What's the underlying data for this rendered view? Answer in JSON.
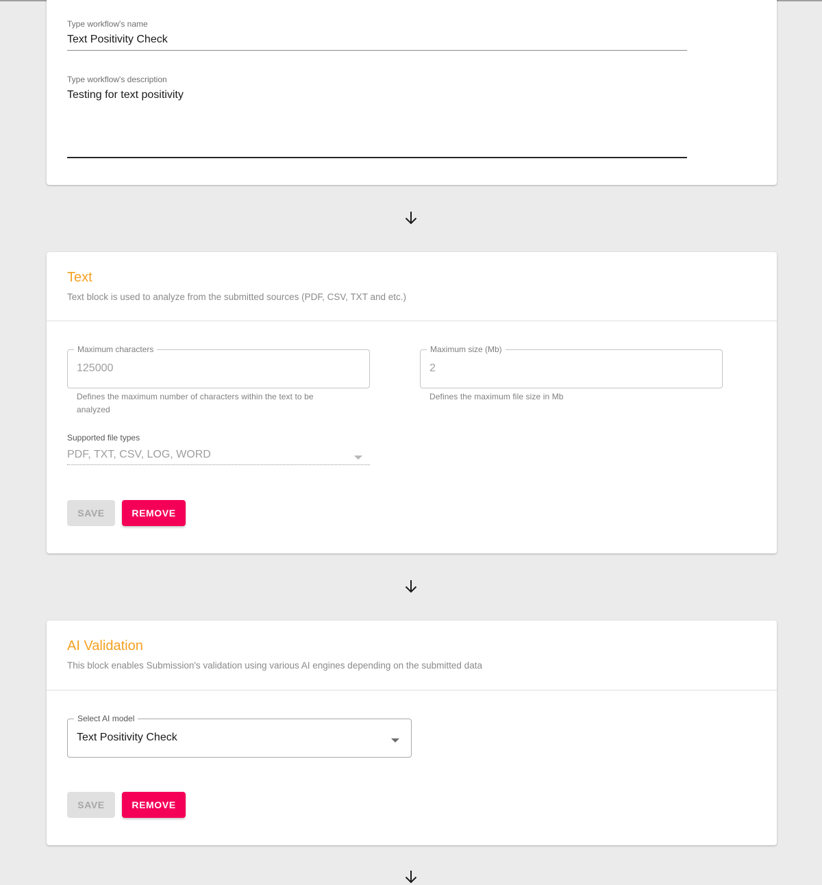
{
  "workflow": {
    "name_label": "Type workflow's name",
    "name_value": "Text Positivity Check",
    "description_label": "Type workflow's description",
    "description_value": "Testing for text positivity"
  },
  "text_block": {
    "title": "Text",
    "description": "Text block is used to analyze from the submitted sources (PDF, CSV, TXT and etc.)",
    "max_chars": {
      "label": "Maximum characters",
      "value": "125000",
      "helper_line1": "Defines the maximum number of characters within the text to be",
      "helper_line2": "analyzed"
    },
    "max_size": {
      "label": "Maximum size (Mb)",
      "value": "2",
      "helper": "Defines the maximum file size in Mb"
    },
    "file_types": {
      "label": "Supported file types",
      "value": "PDF, TXT, CSV, LOG, WORD"
    },
    "save_label": "SAVE",
    "remove_label": "REMOVE"
  },
  "ai_block": {
    "title": "AI Validation",
    "description": "This block enables Submission's validation using various AI engines depending on the submitted data",
    "model": {
      "label": "Select AI model",
      "value": "Text Positivity Check"
    },
    "save_label": "SAVE",
    "remove_label": "REMOVE"
  },
  "icons": {
    "flow_arrow": "arrow-down-icon",
    "dropdown": "caret-down-icon"
  },
  "colors": {
    "accent_title": "#f5a020",
    "remove_button": "#f50057",
    "save_disabled": "#e0e0e0",
    "page_background": "#ebebeb"
  }
}
